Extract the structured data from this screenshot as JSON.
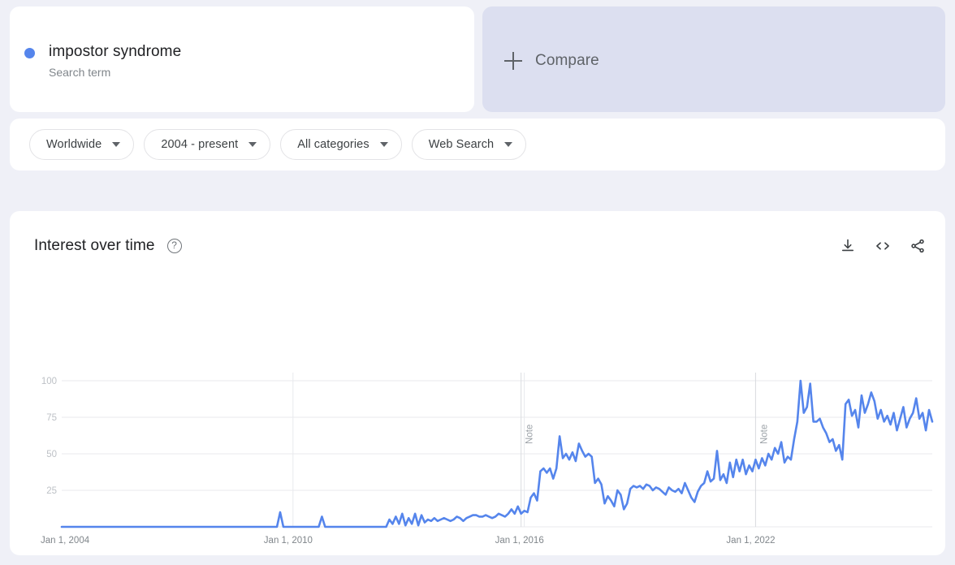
{
  "search_card": {
    "term": "impostor syndrome",
    "subtitle": "Search term",
    "dot_color": "#5585ec"
  },
  "compare_card": {
    "label": "Compare",
    "icon": "plus-icon"
  },
  "filters": [
    {
      "label": "Worldwide",
      "icon": "chevron-down-icon"
    },
    {
      "label": "2004 - present",
      "icon": "chevron-down-icon"
    },
    {
      "label": "All categories",
      "icon": "chevron-down-icon"
    },
    {
      "label": "Web Search",
      "icon": "chevron-down-icon"
    }
  ],
  "chart_panel": {
    "title": "Interest over time",
    "help_icon": "help-circle-icon",
    "help_glyph": "?",
    "actions": [
      {
        "name": "download-icon",
        "tooltip": "Download"
      },
      {
        "name": "embed-code-icon",
        "tooltip": "Embed"
      },
      {
        "name": "share-icon",
        "tooltip": "Share"
      }
    ]
  },
  "chart_data": {
    "type": "line",
    "title": "Interest over time",
    "xlabel": "",
    "ylabel": "",
    "ylim": [
      0,
      100
    ],
    "yticks": [
      25,
      50,
      75,
      100
    ],
    "ytick_labels": [
      "25",
      "50",
      "75",
      "100"
    ],
    "grid": true,
    "legend": false,
    "line_color": "#5585ec",
    "line_width": 2.6,
    "x_start": "2004-01",
    "x_end": "2024-08",
    "x_interval": "monthly",
    "xtick_labels": [
      "Jan 1, 2004",
      "Jan 1, 2010",
      "Jan 1, 2016",
      "Jan 1, 2022"
    ],
    "xtick_positions": [
      "2004-01",
      "2010-01",
      "2016-01",
      "2022-01"
    ],
    "annotations": [
      {
        "label": "Note",
        "at": "2015-12",
        "orientation": "vertical"
      },
      {
        "label": "Note",
        "at": "2022-01",
        "orientation": "vertical"
      }
    ],
    "series": [
      {
        "name": "impostor syndrome",
        "color": "#5585ec",
        "values": [
          0,
          0,
          0,
          0,
          0,
          0,
          0,
          0,
          0,
          0,
          0,
          0,
          0,
          0,
          0,
          0,
          0,
          0,
          0,
          0,
          0,
          0,
          0,
          0,
          0,
          0,
          0,
          0,
          0,
          0,
          0,
          0,
          0,
          0,
          0,
          0,
          0,
          0,
          0,
          0,
          0,
          0,
          0,
          0,
          0,
          0,
          0,
          0,
          0,
          0,
          0,
          0,
          0,
          0,
          0,
          0,
          0,
          0,
          0,
          0,
          0,
          0,
          0,
          0,
          0,
          0,
          0,
          0,
          10,
          0,
          0,
          0,
          0,
          0,
          0,
          0,
          0,
          0,
          0,
          0,
          0,
          7,
          0,
          0,
          0,
          0,
          0,
          0,
          0,
          0,
          0,
          0,
          0,
          0,
          0,
          0,
          0,
          0,
          0,
          0,
          0,
          0,
          5,
          2,
          7,
          2,
          9,
          1,
          6,
          2,
          9,
          1,
          8,
          3,
          5,
          4,
          6,
          4,
          5,
          6,
          5,
          4,
          5,
          7,
          6,
          4,
          6,
          7,
          8,
          8,
          7,
          7,
          8,
          7,
          6,
          7,
          9,
          8,
          7,
          9,
          12,
          9,
          14,
          9,
          11,
          10,
          20,
          23,
          18,
          38,
          40,
          37,
          40,
          33,
          40,
          62,
          47,
          50,
          46,
          51,
          45,
          57,
          52,
          48,
          50,
          48,
          30,
          33,
          29,
          16,
          21,
          18,
          14,
          25,
          22,
          12,
          16,
          26,
          28,
          27,
          28,
          26,
          29,
          28,
          25,
          27,
          26,
          24,
          22,
          27,
          25,
          24,
          26,
          23,
          30,
          25,
          20,
          17,
          24,
          28,
          30,
          38,
          31,
          33,
          52,
          32,
          36,
          30,
          44,
          34,
          46,
          38,
          46,
          36,
          42,
          38,
          46,
          40,
          47,
          42,
          50,
          46,
          54,
          50,
          58,
          44,
          48,
          46,
          60,
          72,
          100,
          78,
          82,
          98,
          72,
          72,
          74,
          68,
          64,
          58,
          60,
          52,
          56,
          46,
          84,
          87,
          76,
          80,
          68,
          90,
          78,
          84,
          92,
          86,
          74,
          80,
          72,
          76,
          70,
          78,
          66,
          74,
          82,
          68,
          74,
          78,
          88,
          74,
          78,
          66,
          80,
          72
        ]
      }
    ]
  }
}
